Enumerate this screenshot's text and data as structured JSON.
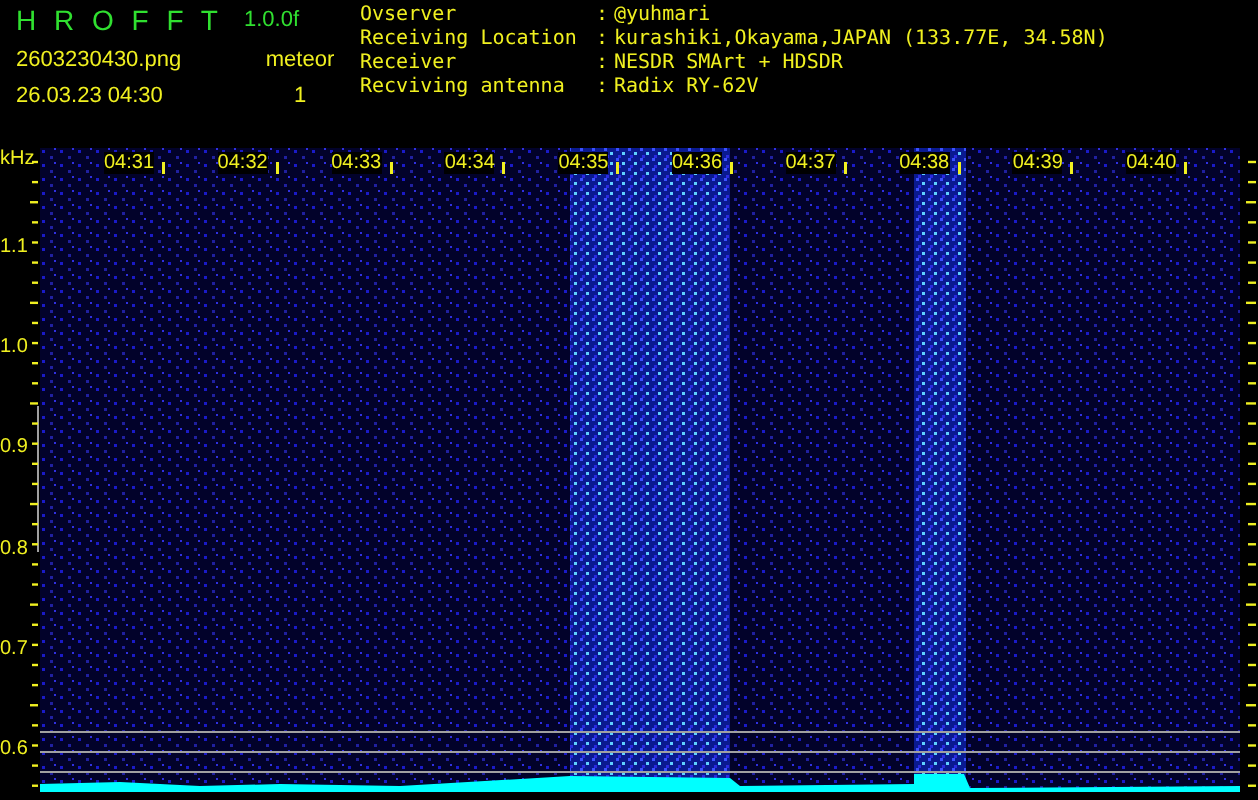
{
  "header": {
    "app_name": "H R O F F T",
    "version": "1.0.0f",
    "filename": "2603230430.png",
    "timestamp": "26.03.23 04:30",
    "count_label": "meteor",
    "count": "1"
  },
  "info": [
    {
      "label": "Ovserver",
      "separator": ":",
      "value": "@yuhmari"
    },
    {
      "label": "Receiving Location",
      "separator": ":",
      "value": "kurashiki,Okayama,JAPAN (133.77E, 34.58N)"
    },
    {
      "label": "Receiver",
      "separator": ":",
      "value": "NESDR SMArt + HDSDR"
    },
    {
      "label": "Recviving antenna",
      "separator": ":",
      "value": "Radix RY-62V"
    }
  ],
  "spectrogram": {
    "frequency_unit": "kHz",
    "frequency_labels": [
      "1.1",
      "1.0",
      "0.9",
      "0.8",
      "0.7",
      "0.6"
    ],
    "time_labels": [
      "04:31",
      "04:32",
      "04:33",
      "04:34",
      "04:35",
      "04:36",
      "04:37",
      "04:38",
      "04:39",
      "04:40"
    ]
  }
}
